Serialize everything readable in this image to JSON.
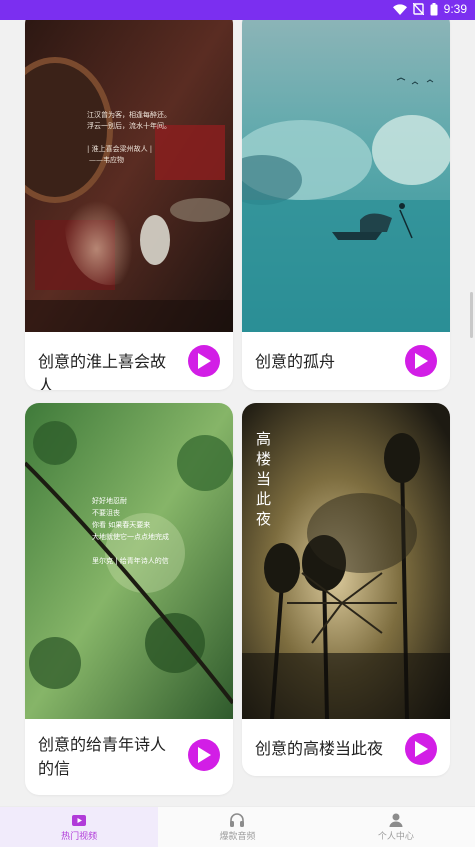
{
  "status_bar": {
    "time": "9:39",
    "background": "#7b2ff0"
  },
  "cards": [
    {
      "title": "创意的淮上喜会故人",
      "image_text": {
        "lines": [
          "江汉曾为客，相逢每醉还。",
          "浮云一别后，流水十年间。"
        ],
        "subtitle": "| 淮上喜会梁州故人 |",
        "author": "——韦应物"
      },
      "play_icon": "play-icon"
    },
    {
      "title": "创意的孤舟",
      "play_icon": "play-icon"
    },
    {
      "title": "创意的给青年诗人的信",
      "image_text": {
        "lines": [
          "好好地忍耐",
          "不要沮丧",
          "你看 如果春天要来",
          "大地就使它一点点地完成"
        ],
        "author": "里尔克 | 给青年诗人的信"
      },
      "play_icon": "play-icon"
    },
    {
      "title": "创意的高楼当此夜",
      "image_text": {
        "vertical": "高楼当此夜"
      },
      "play_icon": "play-icon"
    }
  ],
  "tabs": [
    {
      "label": "热门视频",
      "icon": "video-icon",
      "active": true
    },
    {
      "label": "爆款音频",
      "icon": "headphones-icon",
      "active": false
    },
    {
      "label": "个人中心",
      "icon": "user-icon",
      "active": false
    }
  ],
  "colors": {
    "accent": "#d21ee6",
    "active_tab": "#b13bd9"
  }
}
